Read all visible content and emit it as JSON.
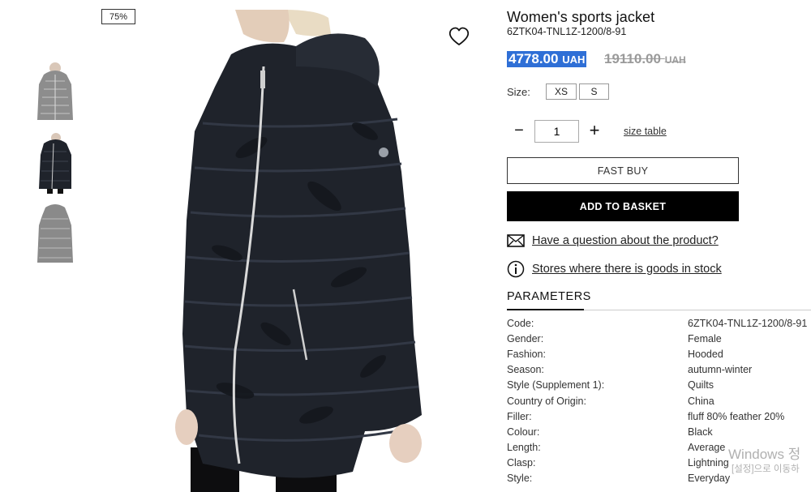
{
  "thumbnails": [
    {
      "alt": "jacket-gray-front"
    },
    {
      "alt": "jacket-black-front"
    },
    {
      "alt": "jacket-gray-back"
    }
  ],
  "badge": {
    "discount": "75%"
  },
  "product": {
    "title": "Women's sports jacket",
    "sku": "6ZTK04-TNL1Z-1200/8-91",
    "price_new": "4778.00",
    "price_new_currency": "UAH",
    "price_old": "19110.00",
    "price_old_currency": "UAH"
  },
  "size": {
    "label": "Size:",
    "options": [
      "XS",
      "S"
    ]
  },
  "quantity": {
    "minus": "−",
    "value": "1",
    "plus": "+",
    "size_table": "size table"
  },
  "buttons": {
    "fast_buy": "FAST BUY",
    "add_to_basket": "ADD TO BASKET"
  },
  "links": {
    "question": "Have a question about the product?",
    "stores": "Stores where there is goods in stock"
  },
  "parameters": {
    "heading": "PARAMETERS",
    "rows": [
      {
        "key": "Code:",
        "value": "6ZTK04-TNL1Z-1200/8-91"
      },
      {
        "key": "Gender:",
        "value": "Female"
      },
      {
        "key": "Fashion:",
        "value": "Hooded"
      },
      {
        "key": "Season:",
        "value": "autumn-winter"
      },
      {
        "key": "Style (Supplement 1):",
        "value": "Quilts"
      },
      {
        "key": "Country of Origin:",
        "value": "China"
      },
      {
        "key": "Filler:",
        "value": "fluff 80% feather 20%"
      },
      {
        "key": "Colour:",
        "value": "Black"
      },
      {
        "key": "Length:",
        "value": "Average"
      },
      {
        "key": "Clasp:",
        "value": "Lightning"
      },
      {
        "key": "Style:",
        "value": "Everyday"
      }
    ]
  },
  "watermark": {
    "line1": "Windows 정",
    "line2": "[설정]으로 이동하"
  },
  "colors": {
    "price_highlight": "#2f6fd6",
    "basket_button": "#000000",
    "jacket": "#1f232b"
  }
}
